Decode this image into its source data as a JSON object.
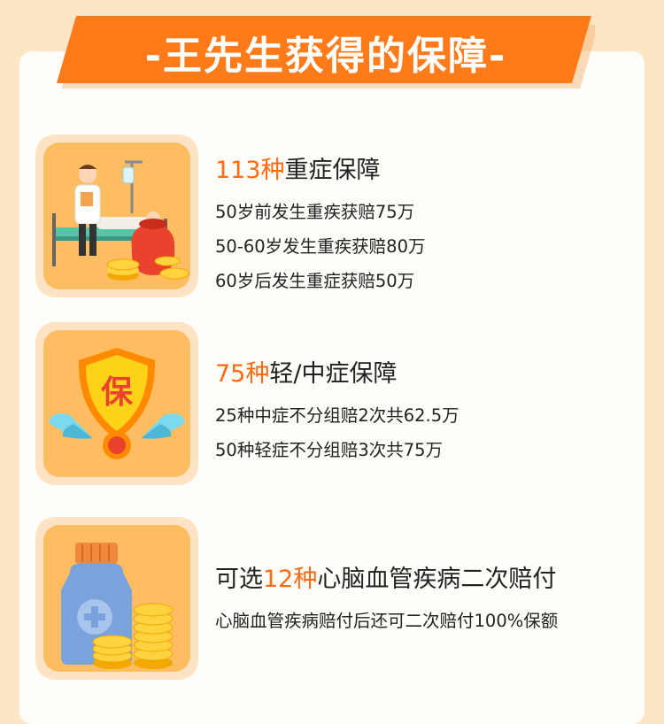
{
  "colors": {
    "background": "#fde6c6",
    "card": "#fffdf9",
    "banner": "#ff7b1a",
    "highlight": "#ff6a10",
    "icon_tile": "#ffbd62",
    "text": "#222222"
  },
  "banner": {
    "title": "-王先生获得的保障-"
  },
  "items": [
    {
      "icon": "doctor-patient-money-bag-icon",
      "title_highlight": "113种",
      "title_rest": "重症保障",
      "lines": [
        "50岁前发生重疾获赔75万",
        "50-60岁发生重疾获赔80万",
        "60岁后发生重症获赔50万"
      ]
    },
    {
      "icon": "shield-wings-bao-icon",
      "shield_char": "保",
      "title_highlight": "75种",
      "title_rest": "轻/中症保障",
      "lines": [
        "25种中症不分组赔2次共62.5万",
        "50种轻症不分组赔3次共75万"
      ]
    },
    {
      "icon": "medicine-bottle-coins-icon",
      "title_pre": "可选",
      "title_highlight": "12种",
      "title_rest": "心脑血管疾病二次赔付",
      "lines": [
        "心脑血管疾病赔付后还可二次赔付100%保额"
      ]
    }
  ]
}
